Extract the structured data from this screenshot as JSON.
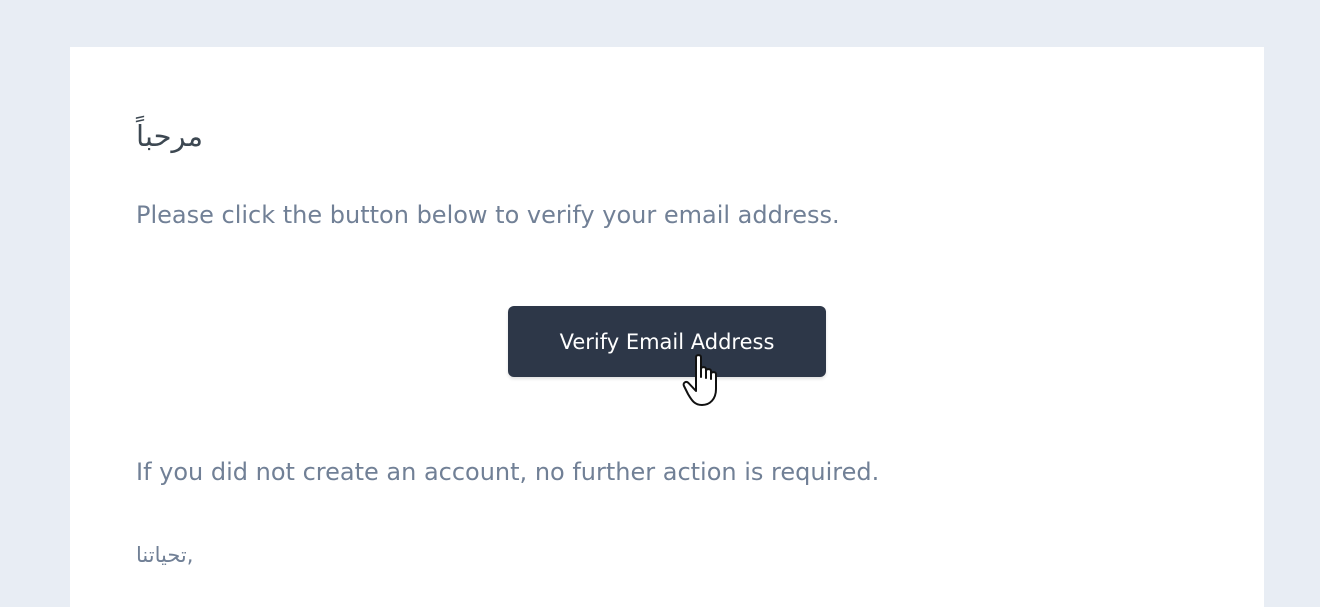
{
  "email": {
    "greeting": "مرحباً",
    "intro_line": "Please click the button below to verify your email address.",
    "action_button_label": "Verify Email Address",
    "outro_line": "If you did not create an account, no further action is required.",
    "salutation": "تحياتنا,",
    "signature": ""
  },
  "colors": {
    "page_background": "#e8edf4",
    "card_background": "#ffffff",
    "button_background": "#2d3748",
    "button_text": "#ffffff",
    "body_text": "#718096",
    "heading_text": "#3d4852"
  },
  "icons": {
    "cursor": "hand-pointer-icon"
  }
}
